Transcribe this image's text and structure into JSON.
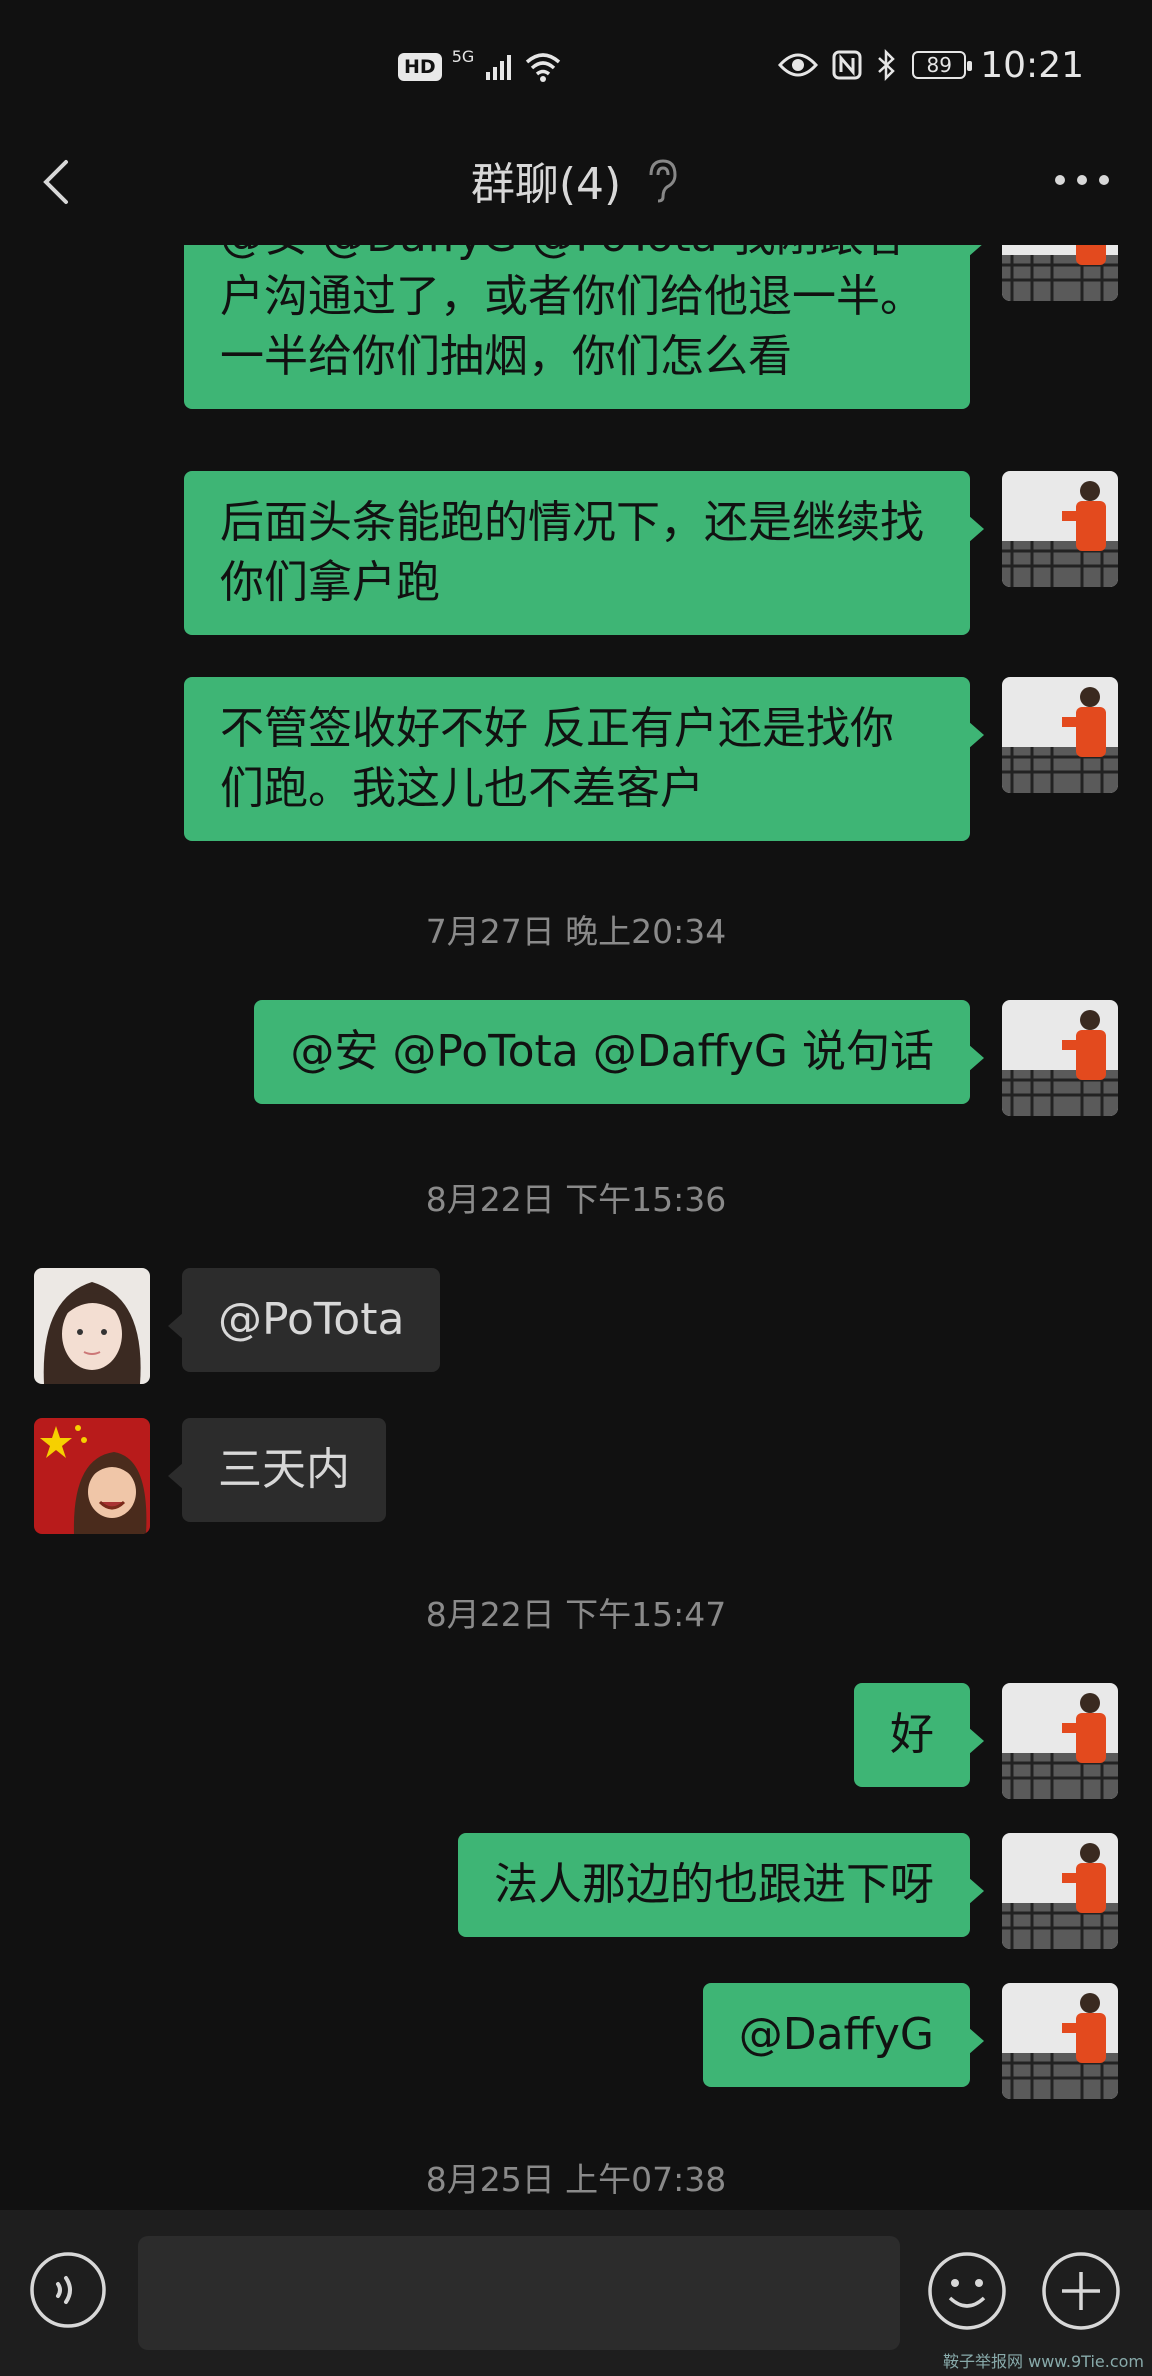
{
  "status_bar": {
    "hd": "HD",
    "network": "5G",
    "battery": "89",
    "time": "10:21"
  },
  "header": {
    "title": "群聊(4)"
  },
  "messages": [
    {
      "text": "@安  @DaffyG @PoTota  我刚跟客户沟通过了，或者你们给他退一半。一半给你们抽烟，你们怎么看",
      "side": "out"
    },
    {
      "text": "后面头条能跑的情况下，还是继续找你们拿户跑",
      "side": "out"
    },
    {
      "text": "不管签收好不好 反正有户还是找你们跑。我这儿也不差客户",
      "side": "out"
    },
    {
      "timestamp": "7月27日 晚上20:34"
    },
    {
      "text": "@安  @PoTota @DaffyG  说句话",
      "side": "out"
    },
    {
      "timestamp": "8月22日 下午15:36"
    },
    {
      "text": "@PoTota",
      "side": "in"
    },
    {
      "text": "三天内",
      "side": "in"
    },
    {
      "timestamp": "8月22日 下午15:47"
    },
    {
      "text": "好",
      "side": "out"
    },
    {
      "text": "法人那边的也跟进下呀",
      "side": "out"
    },
    {
      "text": "@DaffyG",
      "side": "out"
    },
    {
      "timestamp": "8月25日 上午07:38"
    }
  ],
  "input": {
    "placeholder": ""
  },
  "watermark": "鞍子举报网 www.9Tie.com",
  "colors": {
    "background": "#111111",
    "outgoing_bubble": "#3eb575",
    "incoming_bubble": "#2c2c2c",
    "timestamp": "#8a8a8a"
  }
}
